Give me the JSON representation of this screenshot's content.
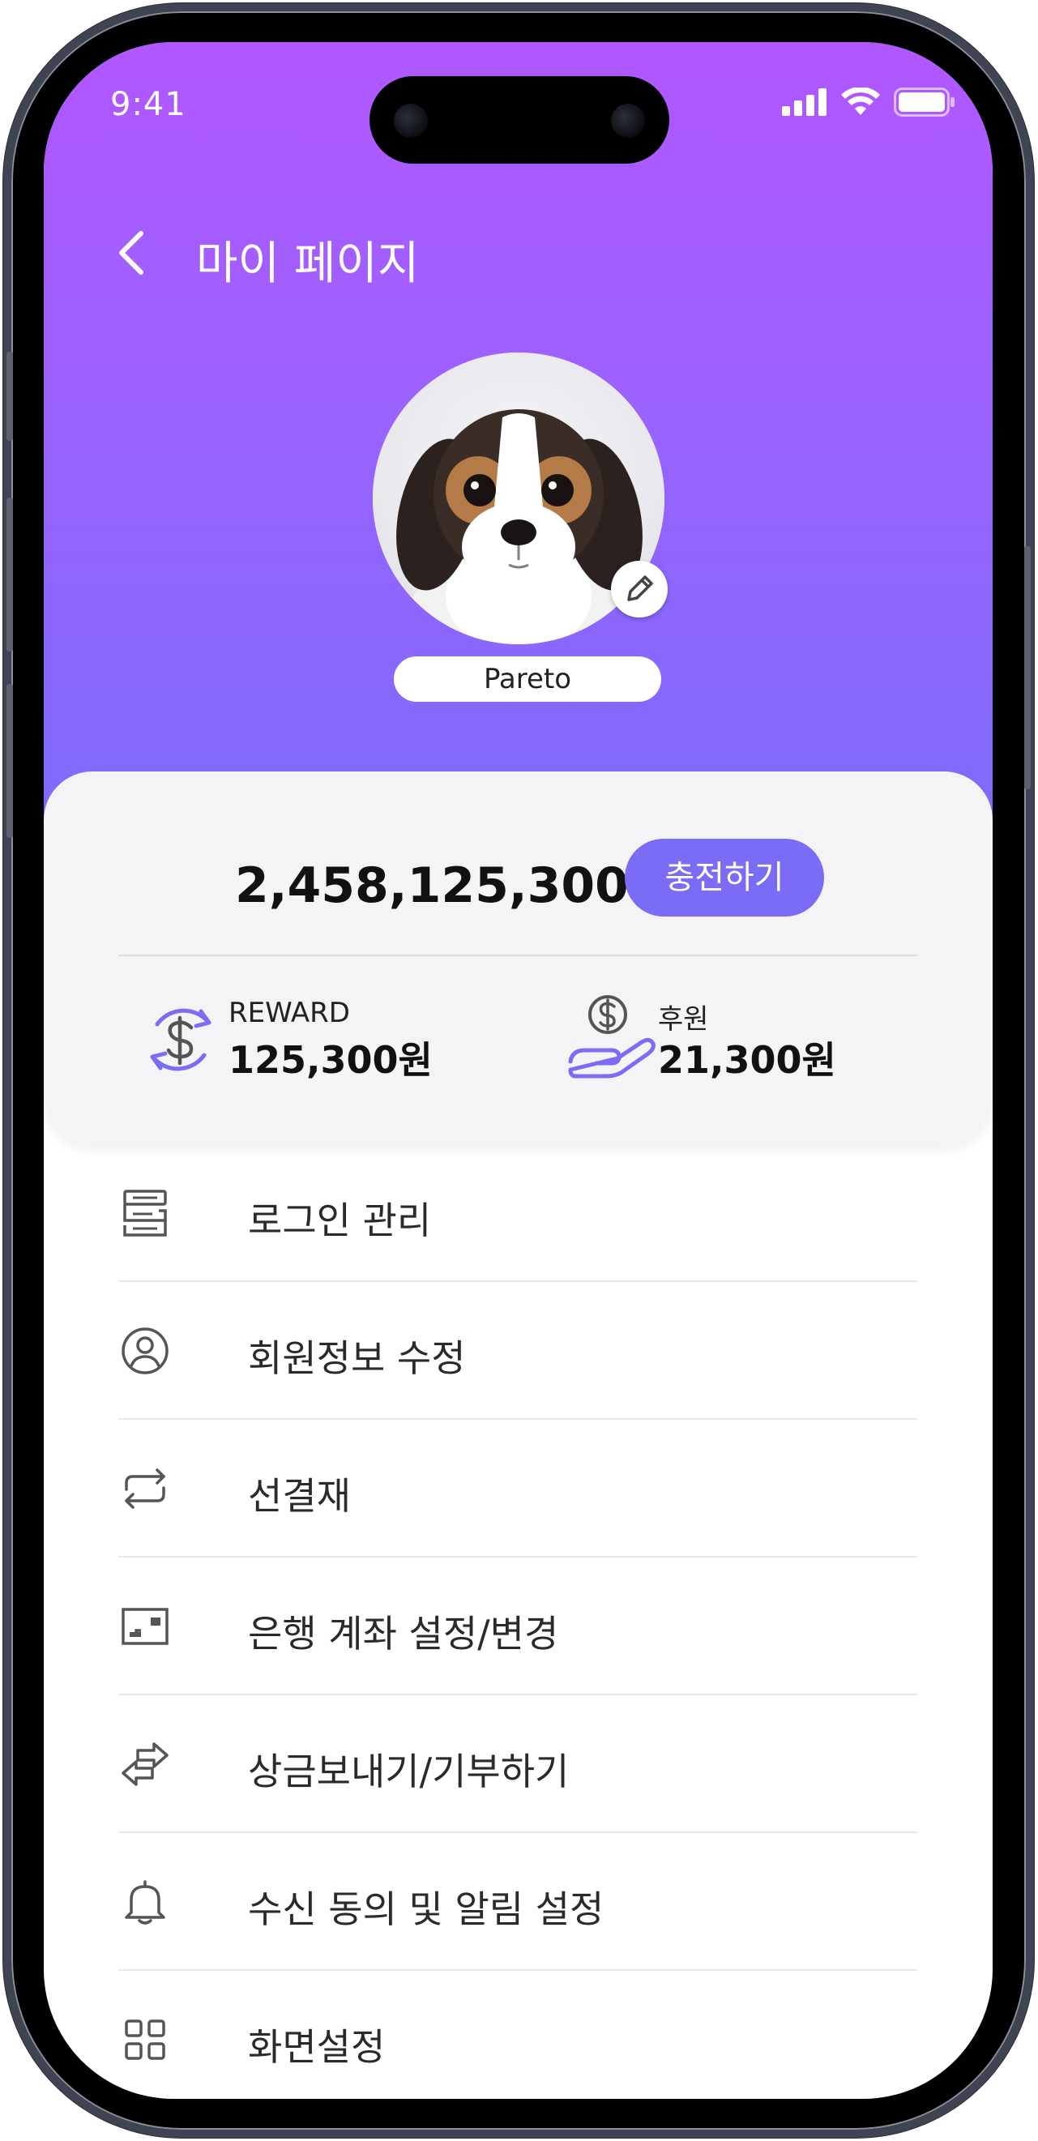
{
  "status_bar": {
    "time": "9:41"
  },
  "header": {
    "title": "마이 페이지",
    "gradient_top": "#b157ff",
    "gradient_bottom": "#7b6cfb"
  },
  "profile": {
    "name": "Pareto"
  },
  "balance": {
    "amount": "2,458,125,300원",
    "charge_label": "충전하기",
    "accent": "#7b6cf6"
  },
  "stats": [
    {
      "icon": "reward-exchange-icon",
      "label": "REWARD",
      "value": "125,300원"
    },
    {
      "icon": "donation-hand-icon",
      "label": "후원",
      "value": "21,300원"
    }
  ],
  "menu": [
    {
      "icon": "login-manage-icon",
      "label": "로그인 관리"
    },
    {
      "icon": "user-circle-icon",
      "label": "회원정보 수정"
    },
    {
      "icon": "repeat-icon",
      "label": "선결재"
    },
    {
      "icon": "bank-account-icon",
      "label": "은행 계좌 설정/변경"
    },
    {
      "icon": "transfer-icon",
      "label": "상금보내기/기부하기"
    },
    {
      "icon": "bell-icon",
      "label": "수신 동의 및 알림 설정"
    },
    {
      "icon": "grid-icon",
      "label": "화면설정"
    }
  ]
}
